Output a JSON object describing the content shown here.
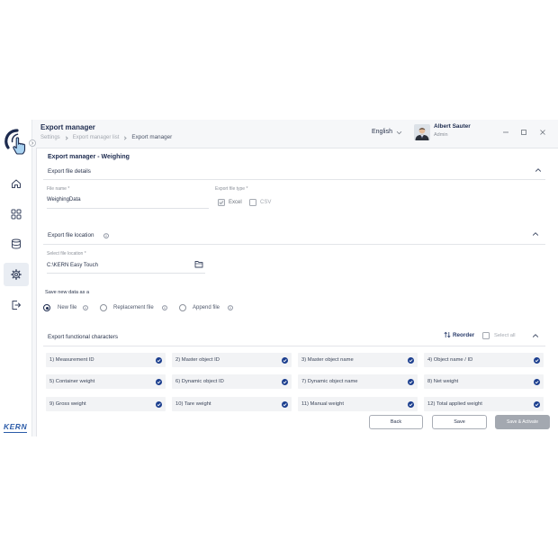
{
  "header": {
    "title": "Export manager",
    "breadcrumb": [
      "Settings",
      "Export manager list",
      "Export manager"
    ],
    "language": "English",
    "user_name": "Albert Sauter",
    "user_role": "Admin"
  },
  "sidebar": {
    "brand": "KERN",
    "items": [
      {
        "icon": "home-icon",
        "selected": false
      },
      {
        "icon": "grid-icon",
        "selected": false
      },
      {
        "icon": "database-icon",
        "selected": false
      },
      {
        "icon": "settings-icon",
        "selected": true
      },
      {
        "icon": "logout-icon",
        "selected": false
      }
    ]
  },
  "page_title": "Export manager - Weighing",
  "file_details": {
    "title": "Export file details",
    "file_name_label": "File name *",
    "file_name_value": "WeighingData",
    "file_type_label": "Export file type *",
    "types": [
      {
        "label": "Excel",
        "checked": true
      },
      {
        "label": "CSV",
        "checked": false
      }
    ]
  },
  "file_location": {
    "title": "Export file location",
    "label": "Select file location *",
    "value": "C:\\KERN Easy Touch"
  },
  "save_mode": {
    "label": "Save new data as a",
    "options": [
      {
        "label": "New file",
        "selected": true
      },
      {
        "label": "Replacement file",
        "selected": false
      },
      {
        "label": "Append file",
        "selected": false
      }
    ]
  },
  "characters": {
    "title": "Export functional characters",
    "reorder": "Reorder",
    "select_all": {
      "label": "Select all",
      "checked": false
    },
    "items": [
      {
        "label": "1) Measurement ID",
        "checked": true
      },
      {
        "label": "2) Master object ID",
        "checked": true
      },
      {
        "label": "3) Master object name",
        "checked": true
      },
      {
        "label": "4) Object name / ID",
        "checked": true
      },
      {
        "label": "5) Container weight",
        "checked": true
      },
      {
        "label": "6) Dynamic object ID",
        "checked": true
      },
      {
        "label": "7) Dynamic object name",
        "checked": true
      },
      {
        "label": "8) Net weight",
        "checked": true
      },
      {
        "label": "9) Gross weight",
        "checked": true
      },
      {
        "label": "10) Tare weight",
        "checked": true
      },
      {
        "label": "11) Manual weight",
        "checked": true
      },
      {
        "label": "12) Total applied weight",
        "checked": true
      }
    ]
  },
  "actions": {
    "back": "Back",
    "save": "Save",
    "save_activate": "Save & Activate"
  },
  "colors": {
    "accent": "#1c3f8f",
    "text": "#1d2b4f",
    "muted": "#8b9099",
    "primary_disabled": "#a3a8b0"
  }
}
